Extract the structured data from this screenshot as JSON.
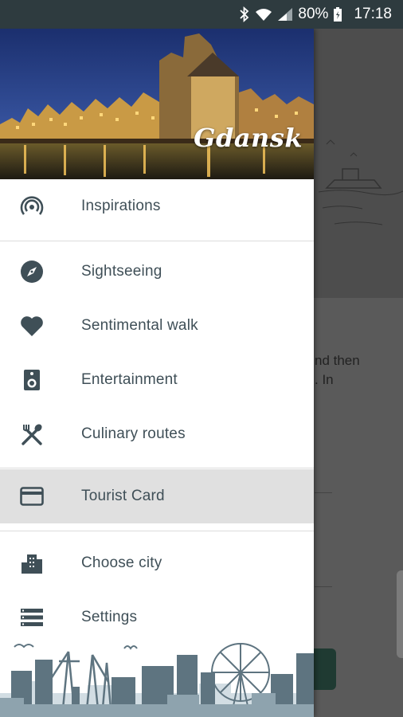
{
  "status_bar": {
    "battery": "80%",
    "time": "17:18",
    "icons": [
      "bluetooth-icon",
      "wifi-icon",
      "signal-icon",
      "battery-icon"
    ]
  },
  "drawer": {
    "city_name": "Gdansk",
    "menu": [
      {
        "label": "Inspirations",
        "icon": "broadcast-icon"
      },
      {
        "label": "Sightseeing",
        "icon": "compass-icon"
      },
      {
        "label": "Sentimental walk",
        "icon": "heart-icon"
      },
      {
        "label": "Entertainment",
        "icon": "speaker-icon"
      },
      {
        "label": "Culinary routes",
        "icon": "cutlery-icon"
      },
      {
        "label": "Tourist Card",
        "icon": "card-icon",
        "active": true
      },
      {
        "label": "Choose city",
        "icon": "city-icon"
      },
      {
        "label": "Settings",
        "icon": "list-icon"
      }
    ]
  },
  "background": {
    "text": "nd then\n. In"
  },
  "colors": {
    "status_bar": "#2e3b3f",
    "icon": "#3f4f57",
    "active_row": "#e0e0e0",
    "skyline": "#5e7480"
  }
}
